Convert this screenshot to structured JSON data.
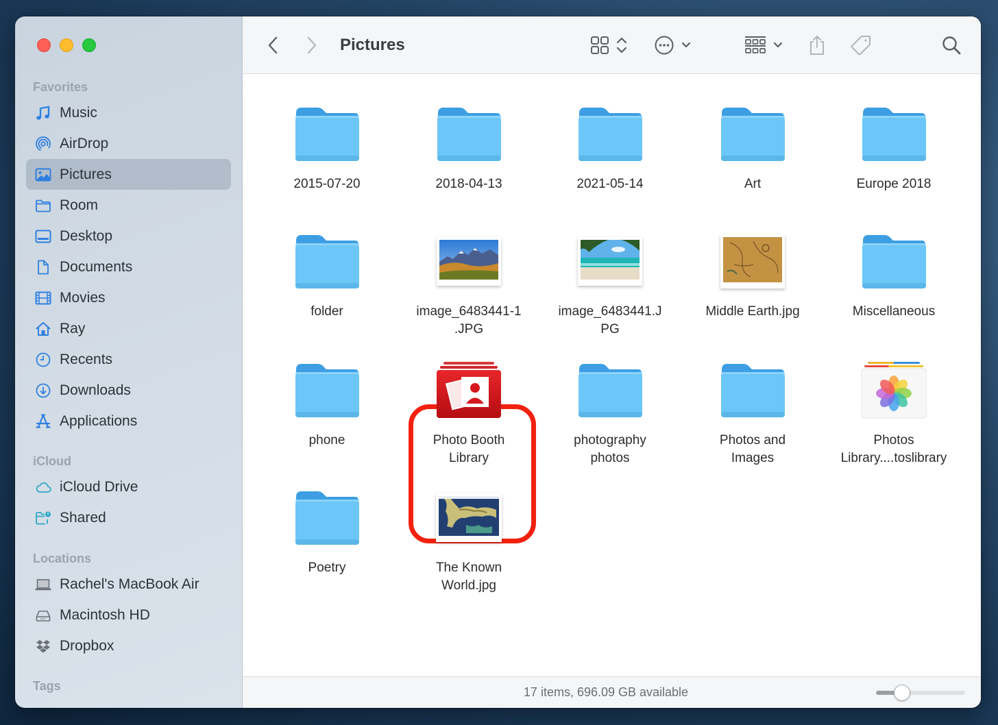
{
  "window": {
    "title": "Pictures",
    "traffic_lights": [
      "close",
      "minimize",
      "zoom"
    ]
  },
  "toolbar": {
    "back_icon": "chevron-left-icon",
    "forward_icon": "chevron-right-icon",
    "title": "Pictures",
    "view_icon": "icon-grid-icon",
    "action_icon": "ellipsis-circle-icon",
    "group_icon": "group-by-icon",
    "share_icon": "share-icon",
    "tag_icon": "tag-icon",
    "search_icon": "search-icon"
  },
  "sidebar": {
    "sections": [
      {
        "heading": "Favorites",
        "items": [
          {
            "label": "Music",
            "icon": "music-note-icon"
          },
          {
            "label": "AirDrop",
            "icon": "airdrop-icon"
          },
          {
            "label": "Pictures",
            "icon": "photo-icon",
            "active": true
          },
          {
            "label": "Room",
            "icon": "folder-icon"
          },
          {
            "label": "Desktop",
            "icon": "desktop-icon"
          },
          {
            "label": "Documents",
            "icon": "document-icon"
          },
          {
            "label": "Movies",
            "icon": "film-icon"
          },
          {
            "label": "Ray",
            "icon": "home-icon"
          },
          {
            "label": "Recents",
            "icon": "clock-icon"
          },
          {
            "label": "Downloads",
            "icon": "download-icon"
          },
          {
            "label": "Applications",
            "icon": "applications-icon"
          }
        ]
      },
      {
        "heading": "iCloud",
        "items": [
          {
            "label": "iCloud Drive",
            "icon": "cloud-icon"
          },
          {
            "label": "Shared",
            "icon": "shared-folder-icon"
          }
        ]
      },
      {
        "heading": "Locations",
        "items": [
          {
            "label": "Rachel's MacBook Air",
            "icon": "laptop-icon"
          },
          {
            "label": "Macintosh HD",
            "icon": "hard-drive-icon"
          },
          {
            "label": "Dropbox",
            "icon": "dropbox-icon"
          }
        ]
      },
      {
        "heading": "Tags",
        "items": []
      }
    ]
  },
  "files": [
    {
      "name": "2015-07-20",
      "type": "folder"
    },
    {
      "name": "2018-04-13",
      "type": "folder"
    },
    {
      "name": "2021-05-14",
      "type": "folder"
    },
    {
      "name": "Art",
      "type": "folder"
    },
    {
      "name": "Europe 2018",
      "type": "folder"
    },
    {
      "name": "folder",
      "type": "folder"
    },
    {
      "name": "image_6483441-1\n.JPG",
      "type": "image-mountains"
    },
    {
      "name": "image_6483441.J\nPG",
      "type": "image-beach"
    },
    {
      "name": "Middle Earth.jpg",
      "type": "image-map"
    },
    {
      "name": "Miscellaneous",
      "type": "folder"
    },
    {
      "name": "phone",
      "type": "folder"
    },
    {
      "name": "Photo Booth\nLibrary",
      "type": "photobooth-library",
      "highlighted": true
    },
    {
      "name": "photography\nphotos",
      "type": "folder"
    },
    {
      "name": "Photos and\nImages",
      "type": "folder"
    },
    {
      "name": "Photos\nLibrary....toslibrary",
      "type": "photos-library"
    },
    {
      "name": "Poetry",
      "type": "folder"
    },
    {
      "name": "The Known\nWorld.jpg",
      "type": "image-world-map"
    }
  ],
  "status": {
    "text": "17 items, 696.09 GB available",
    "icon_size_slider": 0.2
  },
  "colors": {
    "highlight": "#f2210f",
    "folder": "#6cc6f7",
    "accent": "#2f7fe0"
  }
}
